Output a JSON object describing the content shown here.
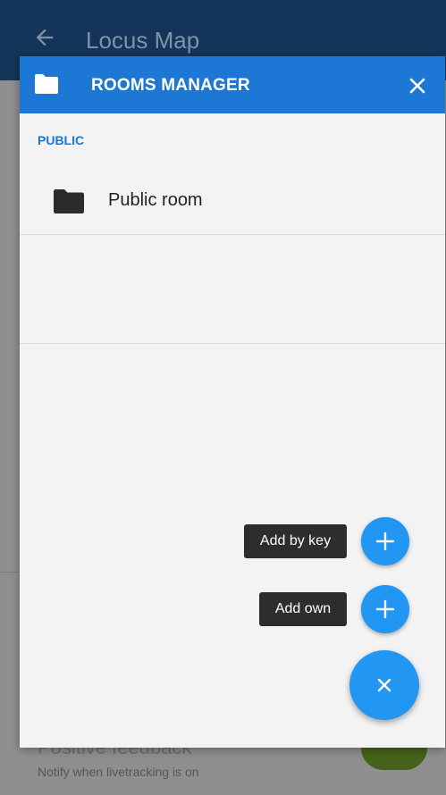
{
  "app": {
    "title": "Locus Map"
  },
  "background_setting": {
    "title": "Positive feedback",
    "description": "Notify when livetracking is on"
  },
  "dialog": {
    "title": "ROOMS MANAGER",
    "section_label": "PUBLIC",
    "rooms": [
      {
        "label": "Public room",
        "icon": "folder-icon"
      }
    ]
  },
  "actions": {
    "add_by_key": "Add by key",
    "add_own": "Add own",
    "main_icon": "close-icon"
  },
  "colors": {
    "header": "#1c78d4",
    "accent": "#2196f3",
    "app_bar": "#143559"
  }
}
